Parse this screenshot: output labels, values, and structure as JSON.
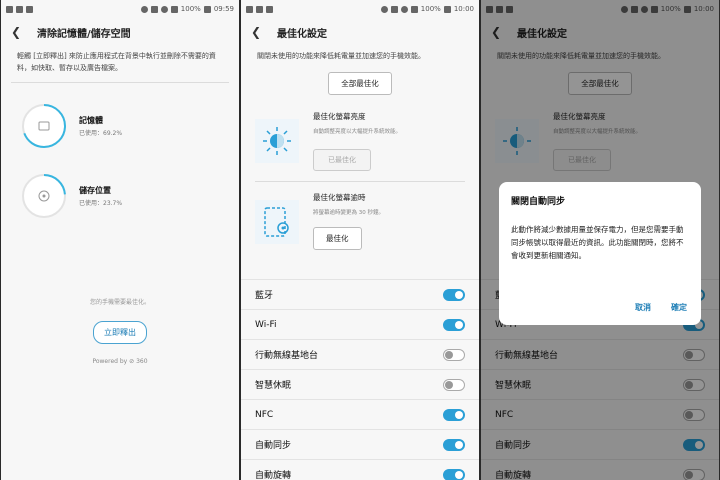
{
  "screen1": {
    "status_time": "09:59",
    "status_battery": "100%",
    "title": "清除記憶體/儲存空間",
    "desc": "輕觸 [立即釋出] 來防止應用程式在背景中執行並刪除不需要的資料，如快取、暫存以及廣告檔案。",
    "memory": {
      "label": "記憶體",
      "used": "已使用：69.2%",
      "fraction": 0.692
    },
    "storage": {
      "label": "儲存位置",
      "used": "已使用：23.7%",
      "fraction": 0.237
    },
    "optimized_msg": "您的手機需要最佳化。",
    "release_button": "立即釋出",
    "powered": "Powered by ⊘ 360"
  },
  "screen2": {
    "status_time": "10:00",
    "status_battery": "100%",
    "title": "最佳化設定",
    "desc": "關閉未使用的功能來降低耗電量並加速您的手機效能。",
    "optimize_all": "全部最佳化",
    "brightness": {
      "title": "最佳化螢幕亮度",
      "sub": "自動調整亮度以大幅提升系統效能。",
      "button": "已最佳化"
    },
    "timeout": {
      "title": "最佳化螢幕逾時",
      "sub": "將螢幕逾時變更為 30 秒鐘。",
      "button": "最佳化"
    },
    "toggles": [
      {
        "label": "藍牙",
        "on": true
      },
      {
        "label": "Wi-Fi",
        "on": true
      },
      {
        "label": "行動無線基地台",
        "on": false
      },
      {
        "label": "智慧休眠",
        "on": false
      },
      {
        "label": "NFC",
        "on": true
      },
      {
        "label": "自動同步",
        "on": true
      },
      {
        "label": "自動旋轉",
        "on": true
      }
    ]
  },
  "screen3": {
    "status_time": "10:00",
    "status_battery": "100%",
    "title": "最佳化設定",
    "desc": "關閉未使用的功能來降低耗電量並加速您的手機效能。",
    "optimize_all": "全部最佳化",
    "brightness": {
      "title": "最佳化螢幕亮度",
      "sub": "自動調整亮度以大幅提升系統效能。",
      "button": "已最佳化"
    },
    "toggles": [
      {
        "label": "藍牙",
        "on": true
      },
      {
        "label": "Wi-Fi",
        "on": true
      },
      {
        "label": "行動無線基地台",
        "on": false
      },
      {
        "label": "智慧休眠",
        "on": false
      },
      {
        "label": "NFC",
        "on": false
      },
      {
        "label": "自動同步",
        "on": true
      },
      {
        "label": "自動旋轉",
        "on": false
      }
    ],
    "dialog": {
      "title": "關閉自動同步",
      "message": "此動作將減少數據用量並保存電力，但是您需要手動同步帳號以取得最近的資訊。此功能關閉時，您將不會收到更新相關通知。",
      "cancel": "取消",
      "confirm": "確定"
    }
  },
  "colors": {
    "accent": "#2a9fd6",
    "text": "#111111"
  }
}
